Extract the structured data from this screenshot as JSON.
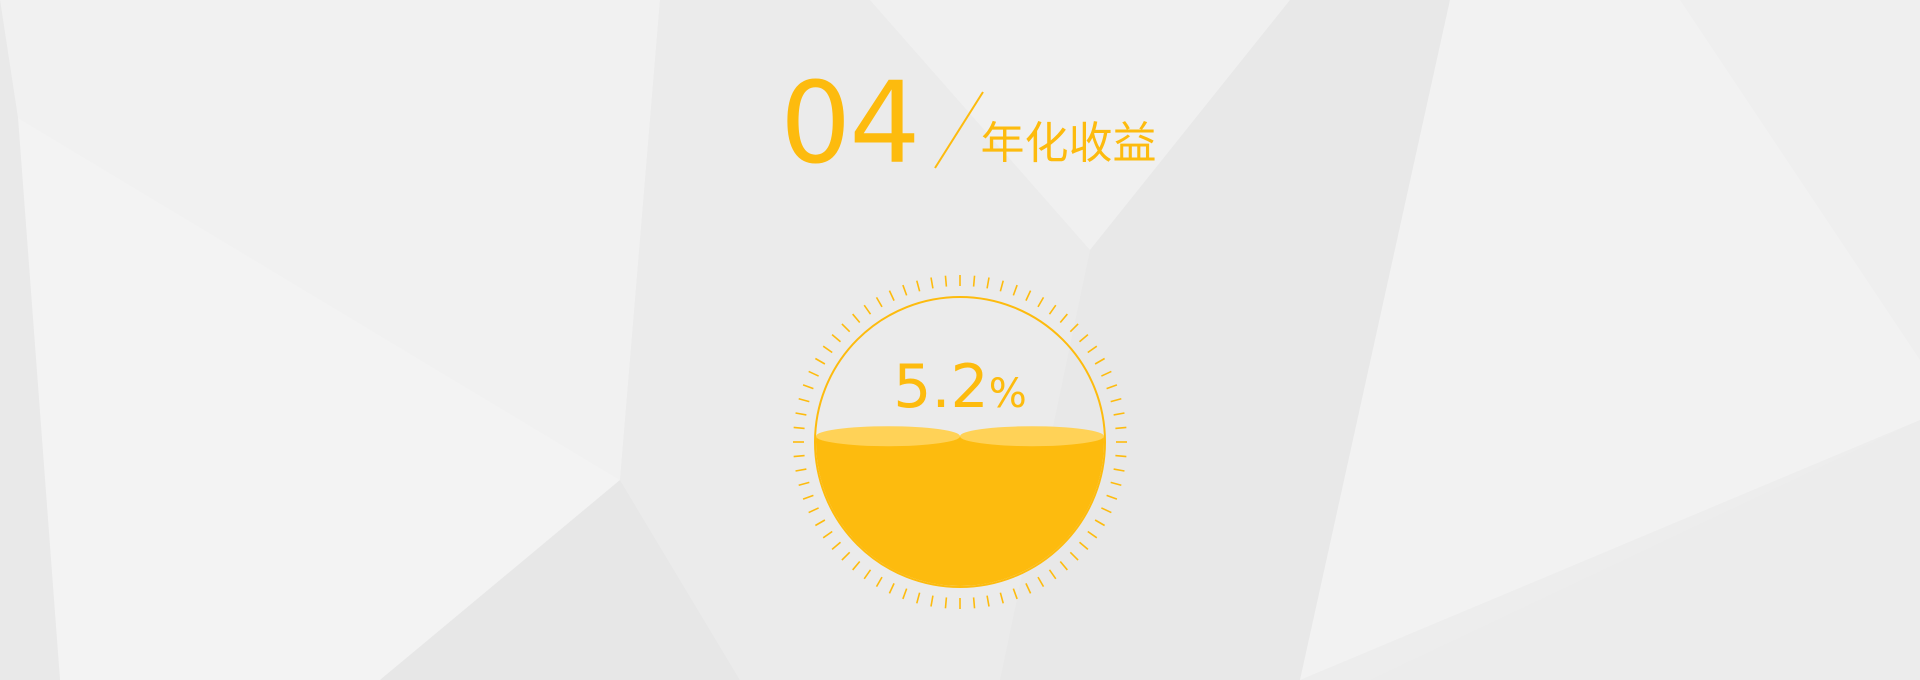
{
  "colors": {
    "accent": "#fdbb0e",
    "accent_light": "#ffd257",
    "background": "#ededed"
  },
  "header": {
    "section_number": "04",
    "section_title": "年化收益"
  },
  "gauge": {
    "value": "5.2",
    "unit": "%",
    "fill_level": 0.52
  }
}
